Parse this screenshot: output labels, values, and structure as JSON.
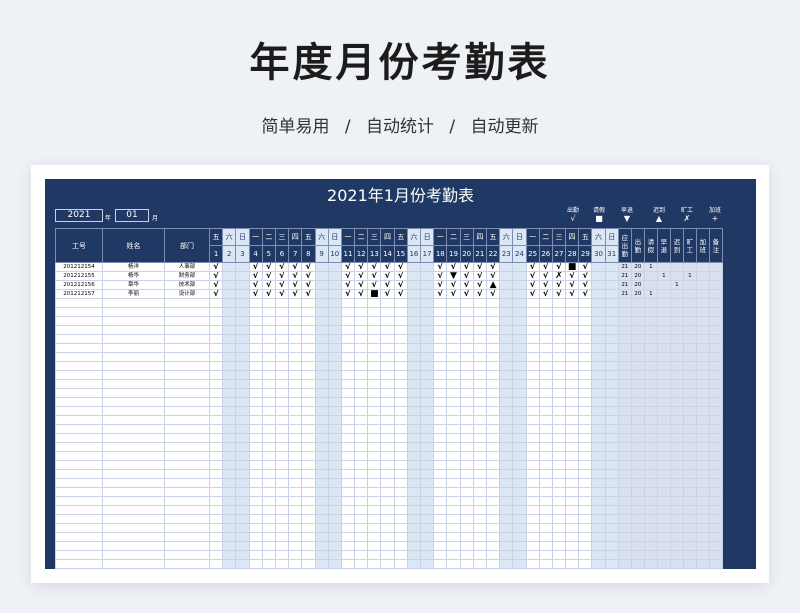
{
  "page": {
    "title": "年度月份考勤表",
    "subtitle": [
      "简单易用",
      "/",
      "自动统计",
      "/",
      "自动更新"
    ]
  },
  "sheet": {
    "title": "2021年1月份考勤表",
    "year": "2021",
    "year_unit": "年",
    "month": "01",
    "month_unit": "月",
    "legend": [
      {
        "label": "出勤",
        "symbol": "√"
      },
      {
        "label": "请假",
        "symbol": "■"
      },
      {
        "label": "早退",
        "symbol": "▼"
      },
      {
        "label": "迟到",
        "symbol": "▲"
      },
      {
        "label": "旷工",
        "symbol": "✗"
      },
      {
        "label": "加班",
        "symbol": "+"
      }
    ],
    "headers": {
      "id": "工号",
      "name": "姓名",
      "dept": "部门"
    },
    "weekdays": [
      "五",
      "六",
      "日",
      "一",
      "二",
      "三",
      "四",
      "五",
      "六",
      "日",
      "一",
      "二",
      "三",
      "四",
      "五",
      "六",
      "日",
      "一",
      "二",
      "三",
      "四",
      "五",
      "六",
      "日",
      "一",
      "二",
      "三",
      "四",
      "五",
      "六",
      "日"
    ],
    "days": [
      "1",
      "2",
      "3",
      "4",
      "5",
      "6",
      "7",
      "8",
      "9",
      "10",
      "11",
      "12",
      "13",
      "14",
      "15",
      "16",
      "17",
      "18",
      "19",
      "20",
      "21",
      "22",
      "23",
      "24",
      "25",
      "26",
      "27",
      "28",
      "29",
      "30",
      "31"
    ],
    "stat_headers": [
      "应出勤",
      "出勤",
      "请假",
      "早退",
      "迟到",
      "旷工",
      "加班",
      "备注"
    ],
    "employees": [
      {
        "id": "201212154",
        "name": "杨洋",
        "dept": "人事部",
        "marks": [
          "√",
          "",
          "",
          "√",
          "√",
          "√",
          "√",
          "√",
          "",
          "",
          "√",
          "√",
          "√",
          "√",
          "√",
          "",
          "",
          "√",
          "√",
          "√",
          "√",
          "√",
          "",
          "",
          "√",
          "√",
          "√",
          "■",
          "√",
          "",
          ""
        ],
        "stats": [
          "21",
          "20",
          "1",
          "",
          "",
          "",
          "",
          ""
        ]
      },
      {
        "id": "201212155",
        "name": "杨华",
        "dept": "财务部",
        "marks": [
          "√",
          "",
          "",
          "√",
          "√",
          "√",
          "√",
          "√",
          "",
          "",
          "√",
          "√",
          "√",
          "√",
          "√",
          "",
          "",
          "√",
          "▼",
          "√",
          "√",
          "√",
          "",
          "",
          "√",
          "√",
          "✗",
          "√",
          "√",
          "",
          ""
        ],
        "stats": [
          "21",
          "20",
          "",
          "1",
          "",
          "1",
          "",
          ""
        ]
      },
      {
        "id": "201212156",
        "name": "章华",
        "dept": "技术部",
        "marks": [
          "√",
          "",
          "",
          "√",
          "√",
          "√",
          "√",
          "√",
          "",
          "",
          "√",
          "√",
          "√",
          "√",
          "√",
          "",
          "",
          "√",
          "√",
          "√",
          "√",
          "▲",
          "",
          "",
          "√",
          "√",
          "√",
          "√",
          "√",
          "",
          ""
        ],
        "stats": [
          "21",
          "20",
          "",
          "",
          "1",
          "",
          "",
          ""
        ]
      },
      {
        "id": "201212157",
        "name": "李丽",
        "dept": "设计部",
        "marks": [
          "√",
          "",
          "",
          "√",
          "√",
          "√",
          "√",
          "√",
          "",
          "",
          "√",
          "√",
          "■",
          "√",
          "√",
          "",
          "",
          "√",
          "√",
          "√",
          "√",
          "√",
          "",
          "",
          "√",
          "√",
          "√",
          "√",
          "√",
          "",
          ""
        ],
        "stats": [
          "21",
          "20",
          "1",
          "",
          "",
          "",
          "",
          ""
        ]
      }
    ],
    "weekend_indices": [
      1,
      2,
      8,
      9,
      15,
      16,
      22,
      23,
      29,
      30
    ]
  }
}
